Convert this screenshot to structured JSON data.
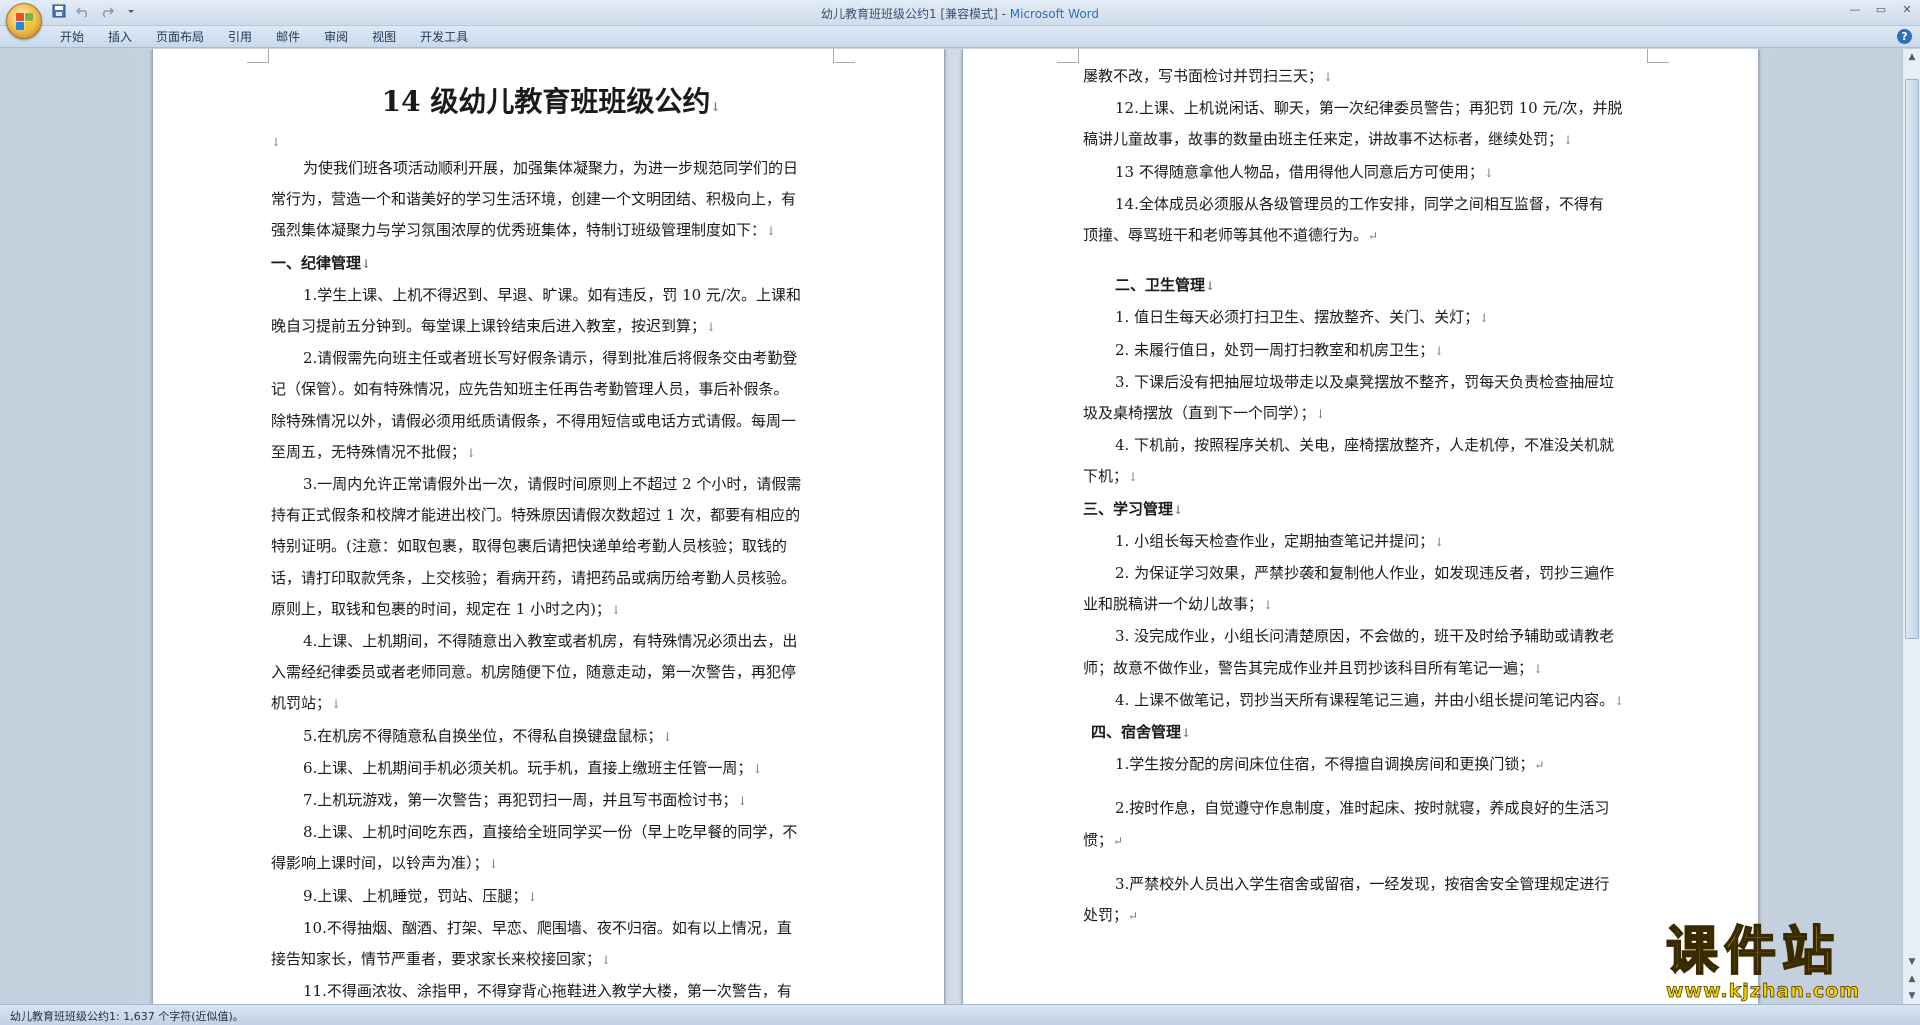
{
  "window": {
    "title": "幼儿教育班班级公约1 [兼容模式]",
    "title_sep": " - ",
    "app_name": "Microsoft Word",
    "controls": [
      "—",
      "▭",
      "✕"
    ]
  },
  "quick_access": {
    "save_icon": "save-icon",
    "undo_icon": "undo-icon",
    "redo_icon": "redo-icon",
    "customize_icon": "dropdown-icon"
  },
  "ribbon": {
    "tabs": [
      "开始",
      "插入",
      "页面布局",
      "引用",
      "邮件",
      "审阅",
      "视图",
      "开发工具"
    ],
    "help": "?"
  },
  "marks": {
    "para": "↓",
    "para_end": "↵"
  },
  "page1": {
    "title": "14 级幼儿教育班班级公约",
    "paragraphs": [
      "为使我们班各项活动顺利开展，加强集体凝聚力，为进一步规范同学们的日",
      "常行为，营造一个和谐美好的学习生活环境，创建一个文明团结、积极向上，有",
      "强烈集体凝聚力与学习氛围浓厚的优秀班集体，特制订班级管理制度如下：",
      "一、纪律管理",
      "1.学生上课、上机不得迟到、早退、旷课。如有违反，罚 10 元/次。上课和",
      "晚自习提前五分钟到。每堂课上课铃结束后进入教室，按迟到算；",
      "2.请假需先向班主任或者班长写好假条请示，得到批准后将假条交由考勤登",
      "记（保管）。如有特殊情况，应先告知班主任再告考勤管理人员，事后补假条。",
      "除特殊情况以外，请假必须用纸质请假条，不得用短信或电话方式请假。每周一",
      "至周五，无特殊情况不批假；",
      "3.一周内允许正常请假外出一次，请假时间原则上不超过 2 个小时，请假需",
      "持有正式假条和校牌才能进出校门。特殊原因请假次数超过 1 次，都要有相应的",
      "特别证明。(注意：如取包裹，取得包裹后请把快递单给考勤人员核验；取钱的",
      "话，请打印取款凭条，上交核验；看病开药，请把药品或病历给考勤人员核验。",
      "原则上，取钱和包裹的时间，规定在 1 小时之内)；",
      "4.上课、上机期间，不得随意出入教室或者机房，有特殊情况必须出去，出",
      "入需经纪律委员或者老师同意。机房随便下位，随意走动，第一次警告，再犯停",
      "机罚站；",
      "5.在机房不得随意私自换坐位，不得私自换键盘鼠标；",
      "6.上课、上机期间手机必须关机。玩手机，直接上缴班主任管一周；",
      "7.上机玩游戏，第一次警告；再犯罚扫一周，并且写书面检讨书；",
      "8.上课、上机时间吃东西，直接给全班同学买一份（早上吃早餐的同学，不",
      "得影响上课时间，以铃声为准）；",
      "9.上课、上机睡觉，罚站、压腿；",
      "10.不得抽烟、酗酒、打架、早恋、爬围墙、夜不归宿。如有以上情况，直",
      "接告知家长，情节严重者，要求家长来校接回家；",
      "11.不得画浓妆、涂指甲，不得穿背心拖鞋进入教学大楼，第一次警告，有"
    ]
  },
  "page2": {
    "paragraphs": [
      "屡教不改，写书面检讨并罚扫三天；",
      "12.上课、上机说闲话、聊天，第一次纪律委员警告；再犯罚 10 元/次，并脱",
      "稿讲儿童故事，故事的数量由班主任来定，讲故事不达标者，继续处罚；",
      "13 不得随意拿他人物品，借用得他人同意后方可使用；",
      "14.全体成员必须服从各级管理员的工作安排，同学之间相互监督，不得有",
      "顶撞、辱骂班干和老师等其他不道德行为。",
      "二、卫生管理",
      "1. 值日生每天必须打扫卫生、摆放整齐、关门、关灯；",
      "2. 未履行值日，处罚一周打扫教室和机房卫生；",
      "3. 下课后没有把抽屉垃圾带走以及桌凳摆放不整齐，罚每天负责检查抽屉垃",
      "圾及桌椅摆放（直到下一个同学）；",
      "4. 下机前，按照程序关机、关电，座椅摆放整齐，人走机停，不准没关机就",
      "下机；",
      "三、学习管理",
      "1. 小组长每天检查作业，定期抽查笔记并提问；",
      "2. 为保证学习效果，严禁抄袭和复制他人作业，如发现违反者，罚抄三遍作",
      "业和脱稿讲一个幼儿故事；",
      "3. 没完成作业，小组长问清楚原因，不会做的，班干及时给予辅助或请教老",
      "师；故意不做作业，警告其完成作业并且罚抄该科目所有笔记一遍；",
      "4. 上课不做笔记，罚抄当天所有课程笔记三遍，并由小组长提问笔记内容。",
      "四、宿舍管理",
      "1.学生按分配的房间床位住宿，不得擅自调换房间和更换门锁；",
      "2.按时作息，自觉遵守作息制度，准时起床、按时就寝，养成良好的生活习",
      "惯；",
      "3.严禁校外人员出入学生宿舍或留宿，一经发现，按宿舍安全管理规定进行",
      "处罚；"
    ]
  },
  "status": {
    "text": "幼儿教育班班级公约1: 1,637 个字符(近似值)。"
  },
  "watermark": {
    "main": "课件站",
    "url": "www.kjzhan.com"
  }
}
